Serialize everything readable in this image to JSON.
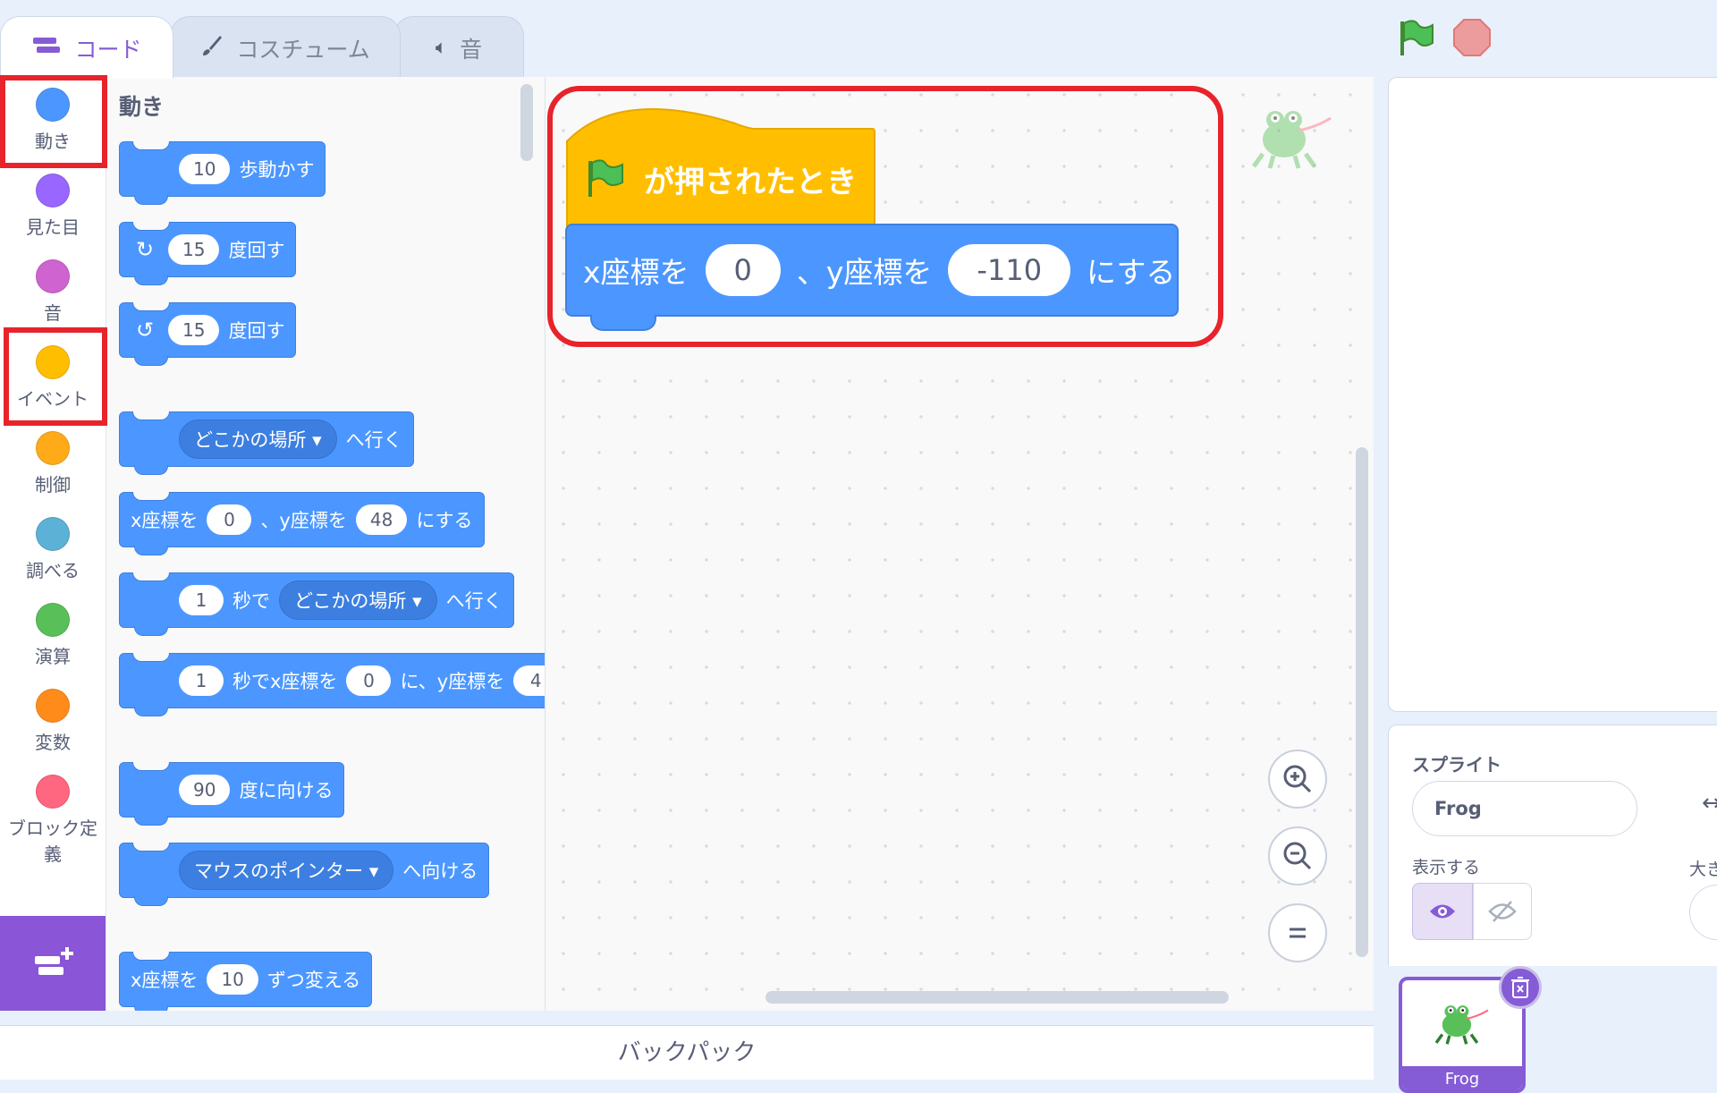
{
  "tabs": {
    "code": "コード",
    "costumes": "コスチューム",
    "sounds": "音"
  },
  "categories": [
    {
      "label": "動き",
      "color": "#4c97ff"
    },
    {
      "label": "見た目",
      "color": "#9966ff"
    },
    {
      "label": "音",
      "color": "#cf63cf"
    },
    {
      "label": "イベント",
      "color": "#ffbf00"
    },
    {
      "label": "制御",
      "color": "#ffab19"
    },
    {
      "label": "調べる",
      "color": "#5cb1d6"
    },
    {
      "label": "演算",
      "color": "#59c059"
    },
    {
      "label": "変数",
      "color": "#ff8c1a"
    },
    {
      "label": "ブロック定",
      "color": "#ff6680"
    }
  ],
  "category_last_line2": "義",
  "palette": {
    "heading": "動き",
    "move": {
      "value": "10",
      "text": "歩動かす"
    },
    "turn_right": {
      "value": "15",
      "text": "度回す"
    },
    "turn_left": {
      "value": "15",
      "text": "度回す"
    },
    "goto": {
      "menu": "どこかの場所",
      "text": "へ行く"
    },
    "gotoxy": {
      "t1": "x座標を",
      "x": "0",
      "t2": "、y座標を",
      "y": "48",
      "t3": "にする"
    },
    "glide": {
      "secs": "1",
      "t1": "秒で",
      "menu": "どこかの場所",
      "t2": "へ行く"
    },
    "glidexy": {
      "secs": "1",
      "t1": "秒でx座標を",
      "x": "0",
      "t2": "に、y座標を",
      "y": "4"
    },
    "point": {
      "value": "90",
      "text": "度に向ける"
    },
    "pointtowards": {
      "menu": "マウスのポインター",
      "text": "へ向ける"
    },
    "changex": {
      "t1": "x座標を",
      "value": "10",
      "t2": "ずつ変える"
    }
  },
  "script": {
    "hat_text": "が押されたとき",
    "setxy": {
      "t1": "x座標を",
      "x": "0",
      "t2": "、y座標を",
      "y": "-110",
      "t3": "にする"
    }
  },
  "backpack": "バックパック",
  "sprite_info": {
    "heading": "スプライト",
    "name": "Frog",
    "show_label": "表示する",
    "size_label": "大き"
  },
  "sprite_tray": {
    "thumb_label": "Frog"
  },
  "colors": {
    "motion": "#4c97ff",
    "events": "#ffbf00",
    "highlight": "#e8232b",
    "accent": "#855cd6"
  }
}
